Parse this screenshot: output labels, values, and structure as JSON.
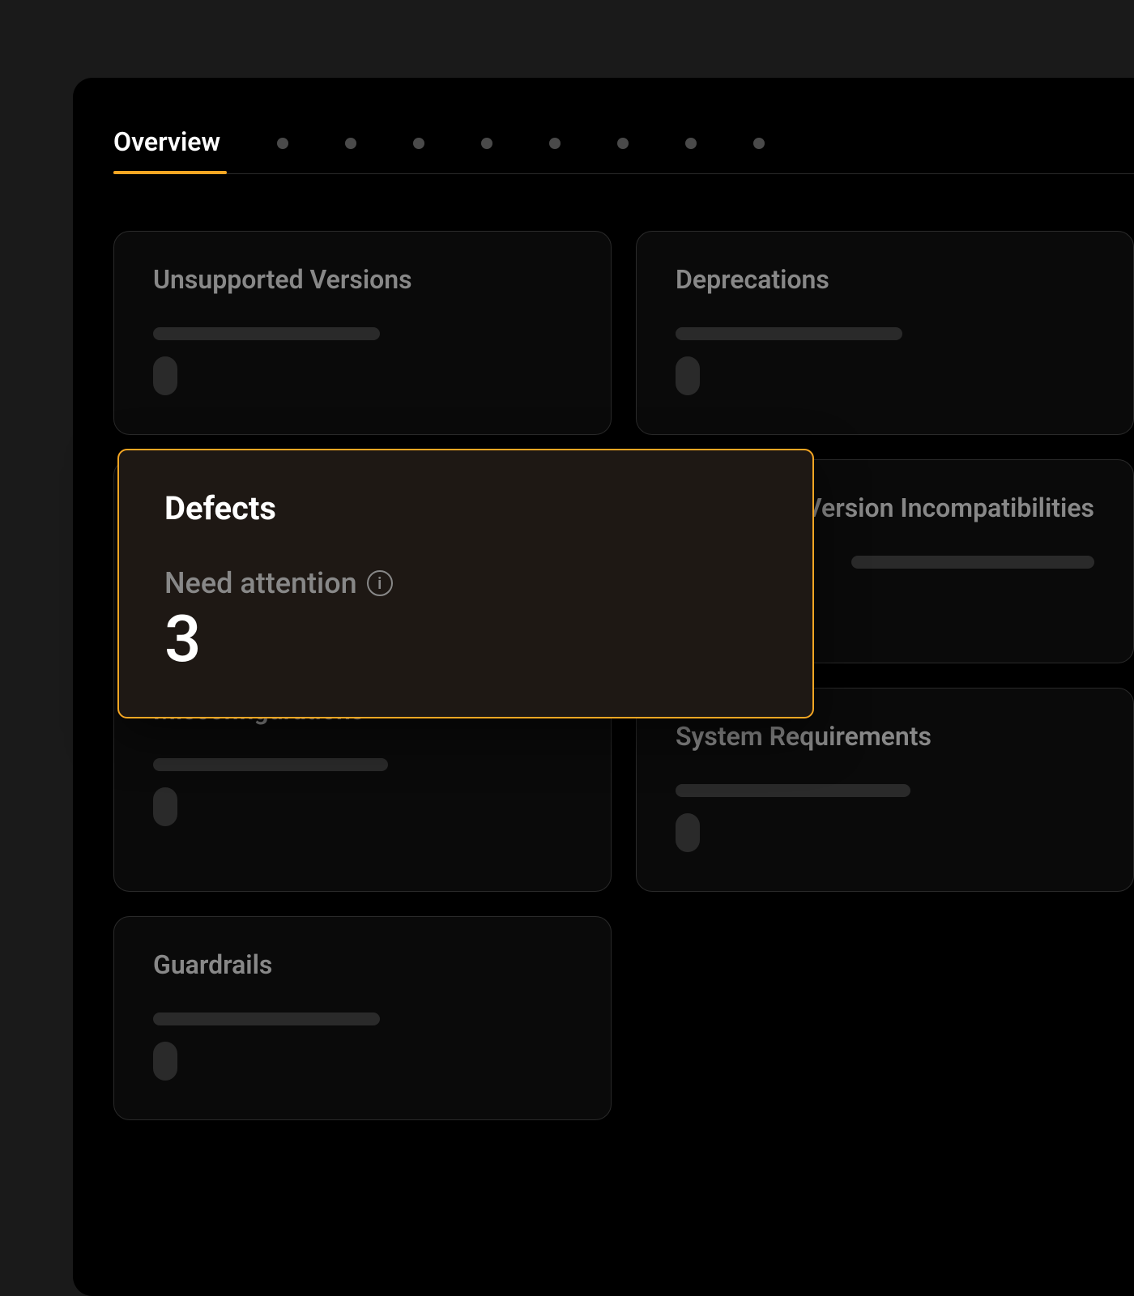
{
  "tabs": {
    "active": "Overview",
    "placeholder_count": 8
  },
  "cards": {
    "unsupported_versions": {
      "title": "Unsupported Versions"
    },
    "deprecations": {
      "title": "Deprecations"
    },
    "misconfigurations": {
      "title": "Misconfigurations"
    },
    "version_incompatibilities": {
      "title": "Version Incompatibilities"
    },
    "system_requirements": {
      "title": "System Requirements"
    },
    "guardrails": {
      "title": "Guardrails"
    }
  },
  "highlight": {
    "title": "Defects",
    "subtitle": "Need attention",
    "count": "3"
  }
}
